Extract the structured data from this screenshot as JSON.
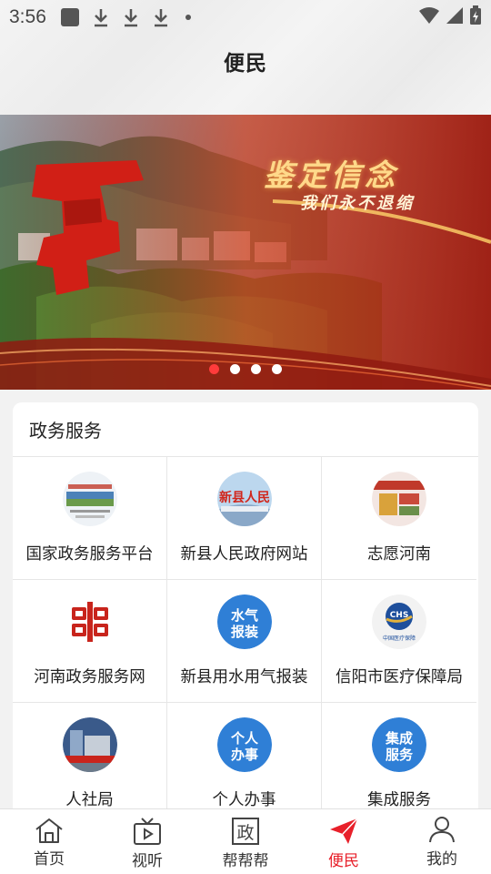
{
  "status_bar": {
    "time": "3:56"
  },
  "header": {
    "title": "便民"
  },
  "banner": {
    "headline": "鉴定信念",
    "subline": "我们永不退缩",
    "slide_count": 4,
    "active_slide": 1
  },
  "services": {
    "section_title": "政务服务",
    "items": [
      {
        "label": "国家政务服务平台",
        "icon": "national-gov-service-icon"
      },
      {
        "label": "新县人民政府网站",
        "icon": "county-gov-website-icon"
      },
      {
        "label": "志愿河南",
        "icon": "volunteer-henan-icon"
      },
      {
        "label": "河南政务服务网",
        "icon": "henan-gov-service-icon"
      },
      {
        "label": "新县用水用气报装",
        "icon": "water-gas-icon"
      },
      {
        "label": "信阳市医疗保障局",
        "icon": "medical-security-icon"
      },
      {
        "label": "人社局",
        "icon": "hr-social-security-icon"
      },
      {
        "label": "个人办事",
        "icon": "personal-affairs-icon"
      },
      {
        "label": "集成服务",
        "icon": "integrated-services-icon"
      }
    ],
    "badge_texts": {
      "water_gas_line1": "水气",
      "water_gas_line2": "报装",
      "personal_line1": "个人",
      "personal_line2": "办事",
      "integrated_line1": "集成",
      "integrated_line2": "服务",
      "county_site": "新县人民",
      "medical_logo": "CHS",
      "medical_caption": "中国医疗保障"
    }
  },
  "tabbar": {
    "items": [
      {
        "label": "首页",
        "icon": "home-icon"
      },
      {
        "label": "视听",
        "icon": "tv-icon"
      },
      {
        "label": "帮帮帮",
        "icon": "gov-badge-icon",
        "glyph": "政"
      },
      {
        "label": "便民",
        "icon": "paper-plane-icon",
        "active": true
      },
      {
        "label": "我的",
        "icon": "user-icon"
      }
    ]
  },
  "colors": {
    "accent": "#e8202a",
    "badge_blue": "#2f7fd6",
    "banner_red": "#c8321c"
  }
}
